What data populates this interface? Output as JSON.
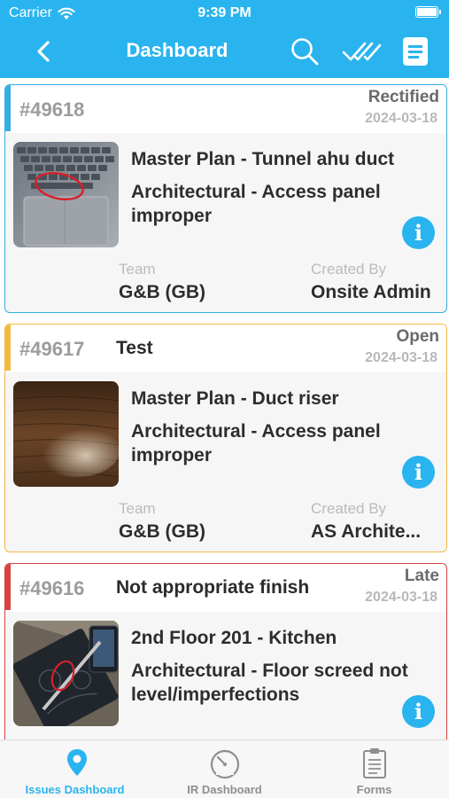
{
  "status_bar": {
    "carrier": "Carrier",
    "time": "9:39 PM",
    "battery_level": 1.0
  },
  "navbar": {
    "title": "Dashboard",
    "icons": [
      "back-chevron-icon",
      "search-icon",
      "double-check-icon",
      "document-list-icon"
    ]
  },
  "colors": {
    "brand": "#2ab4ef",
    "rectified": "#35aee3",
    "open": "#f4b940",
    "late": "#d94040"
  },
  "labels": {
    "team": "Team",
    "created_by": "Created By"
  },
  "issues": [
    {
      "id": "#49618",
      "title": "",
      "status": "Rectified",
      "date": "2024-03-18",
      "location": "Master Plan - Tunnel ahu duct",
      "issue": "Architectural - Access panel improper",
      "team": "G&B (GB)",
      "created_by": "Onsite Admin",
      "thumbnail": "keyboard-photo"
    },
    {
      "id": "#49617",
      "title": "Test",
      "status": "Open",
      "date": "2024-03-18",
      "location": "Master Plan - Duct riser",
      "issue": "Architectural - Access panel improper",
      "team": "G&B (GB)",
      "created_by": "AS Archite...",
      "thumbnail": "wood-table-photo"
    },
    {
      "id": "#49616",
      "title": "Not appropriate finish",
      "status": "Late",
      "date": "2024-03-18",
      "location": "2nd Floor  201 - Kitchen",
      "issue": "Architectural - Floor screed not level/imperfections",
      "team": "",
      "created_by": "",
      "thumbnail": "notebook-photo"
    }
  ],
  "tabs": [
    {
      "label": "Issues Dashboard",
      "icon": "location-pin-icon",
      "active": true
    },
    {
      "label": "IR Dashboard",
      "icon": "gauge-icon",
      "active": false
    },
    {
      "label": "Forms",
      "icon": "clipboard-icon",
      "active": false
    }
  ]
}
